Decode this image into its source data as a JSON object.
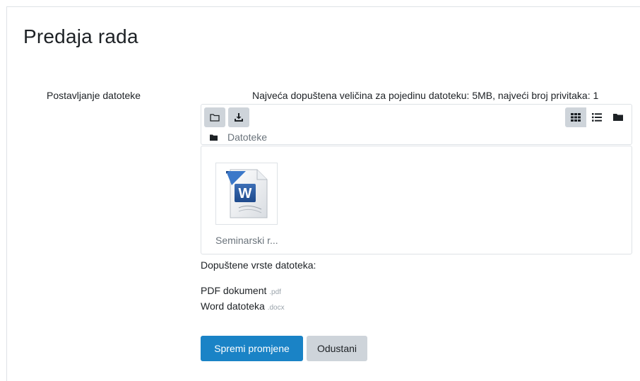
{
  "page": {
    "title": "Predaja rada"
  },
  "upload": {
    "label": "Postavljanje datoteke",
    "limits": "Najveća dopuštena veličina za pojedinu datoteku: 5MB, najveći broj privitaka: 1"
  },
  "filepicker": {
    "toolbar": {
      "left_icons": [
        "folder-outline-icon",
        "download-icon"
      ],
      "view_icons": [
        "grid-view-icon",
        "list-view-icon",
        "folder-view-icon"
      ],
      "active_view": "grid-view-icon"
    },
    "path": {
      "icon": "folder-icon",
      "label": "Datoteke"
    },
    "files": [
      {
        "name": "Seminarski r...",
        "icon": "word-document-icon"
      }
    ]
  },
  "allowed_types": {
    "heading": "Dopuštene vrste datoteka:",
    "items": [
      {
        "label": "PDF dokument",
        "ext": ".pdf"
      },
      {
        "label": "Word datoteka",
        "ext": ".docx"
      }
    ]
  },
  "actions": {
    "save_label": "Spremi promjene",
    "cancel_label": "Odustani"
  },
  "colors": {
    "primary": "#1a83c6",
    "secondary": "#ced4da",
    "muted": "#6a737b",
    "word_blue": "#2a5699"
  }
}
